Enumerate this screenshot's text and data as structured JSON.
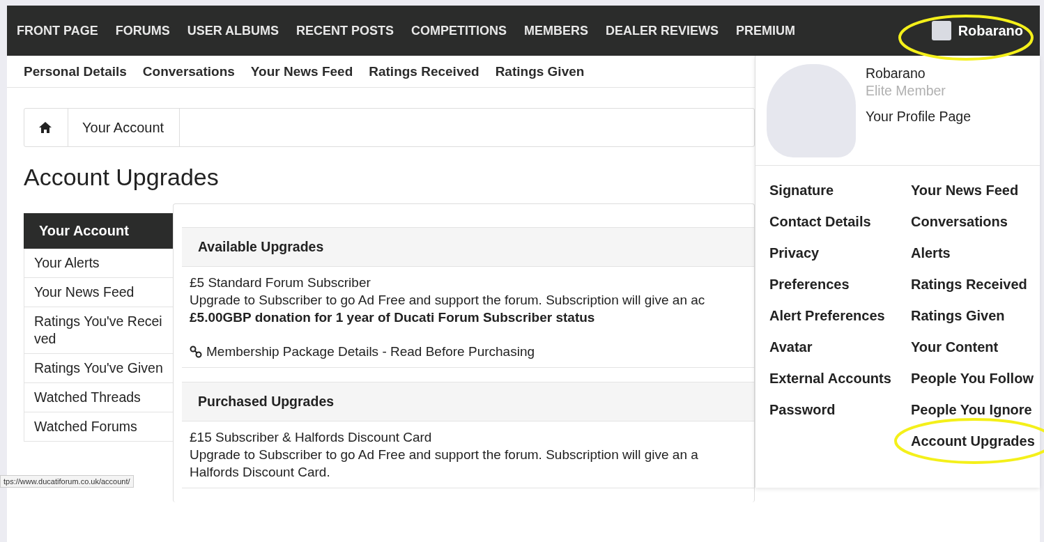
{
  "nav": {
    "items": [
      "FRONT PAGE",
      "FORUMS",
      "USER ALBUMS",
      "RECENT POSTS",
      "COMPETITIONS",
      "MEMBERS",
      "DEALER REVIEWS",
      "PREMIUM"
    ],
    "user": "Robarano"
  },
  "subnav": [
    "Personal Details",
    "Conversations",
    "Your News Feed",
    "Ratings Received",
    "Ratings Given"
  ],
  "breadcrumb": [
    "Your Account"
  ],
  "page_title": "Account Upgrades",
  "sidebar": {
    "title": "Your Account",
    "items": [
      "Your Alerts",
      "Your News Feed",
      "Ratings You've Received",
      "Ratings You've Given",
      "Watched Threads",
      "Watched Forums"
    ]
  },
  "sections": [
    {
      "heading": "Available Upgrades",
      "title": "£5 Standard Forum Subscriber",
      "description": "Upgrade to Subscriber to go Ad Free and support the forum. Subscription will give an ac",
      "note": "£5.00GBP donation for 1 year of Ducati Forum Subscriber status",
      "link": "Membership Package Details - Read Before Purchasing"
    },
    {
      "heading": "Purchased Upgrades",
      "title": "£15 Subscriber & Halfords Discount Card",
      "description": "Upgrade to Subscriber to go Ad Free and support the forum. Subscription will give an a",
      "note_plain": "Halfords Discount Card."
    }
  ],
  "user_menu": {
    "name": "Robarano",
    "rank": "Elite Member",
    "profile_link": "Your Profile Page",
    "left": [
      "Signature",
      "Contact Details",
      "Privacy",
      "Preferences",
      "Alert Preferences",
      "Avatar",
      "External Accounts",
      "Password"
    ],
    "right": [
      "Your News Feed",
      "Conversations",
      "Alerts",
      "Ratings Received",
      "Ratings Given",
      "Your Content",
      "People You Follow",
      "People You Ignore",
      "Account Upgrades"
    ]
  },
  "status_url": "tps://www.ducatiforum.co.uk/account/"
}
